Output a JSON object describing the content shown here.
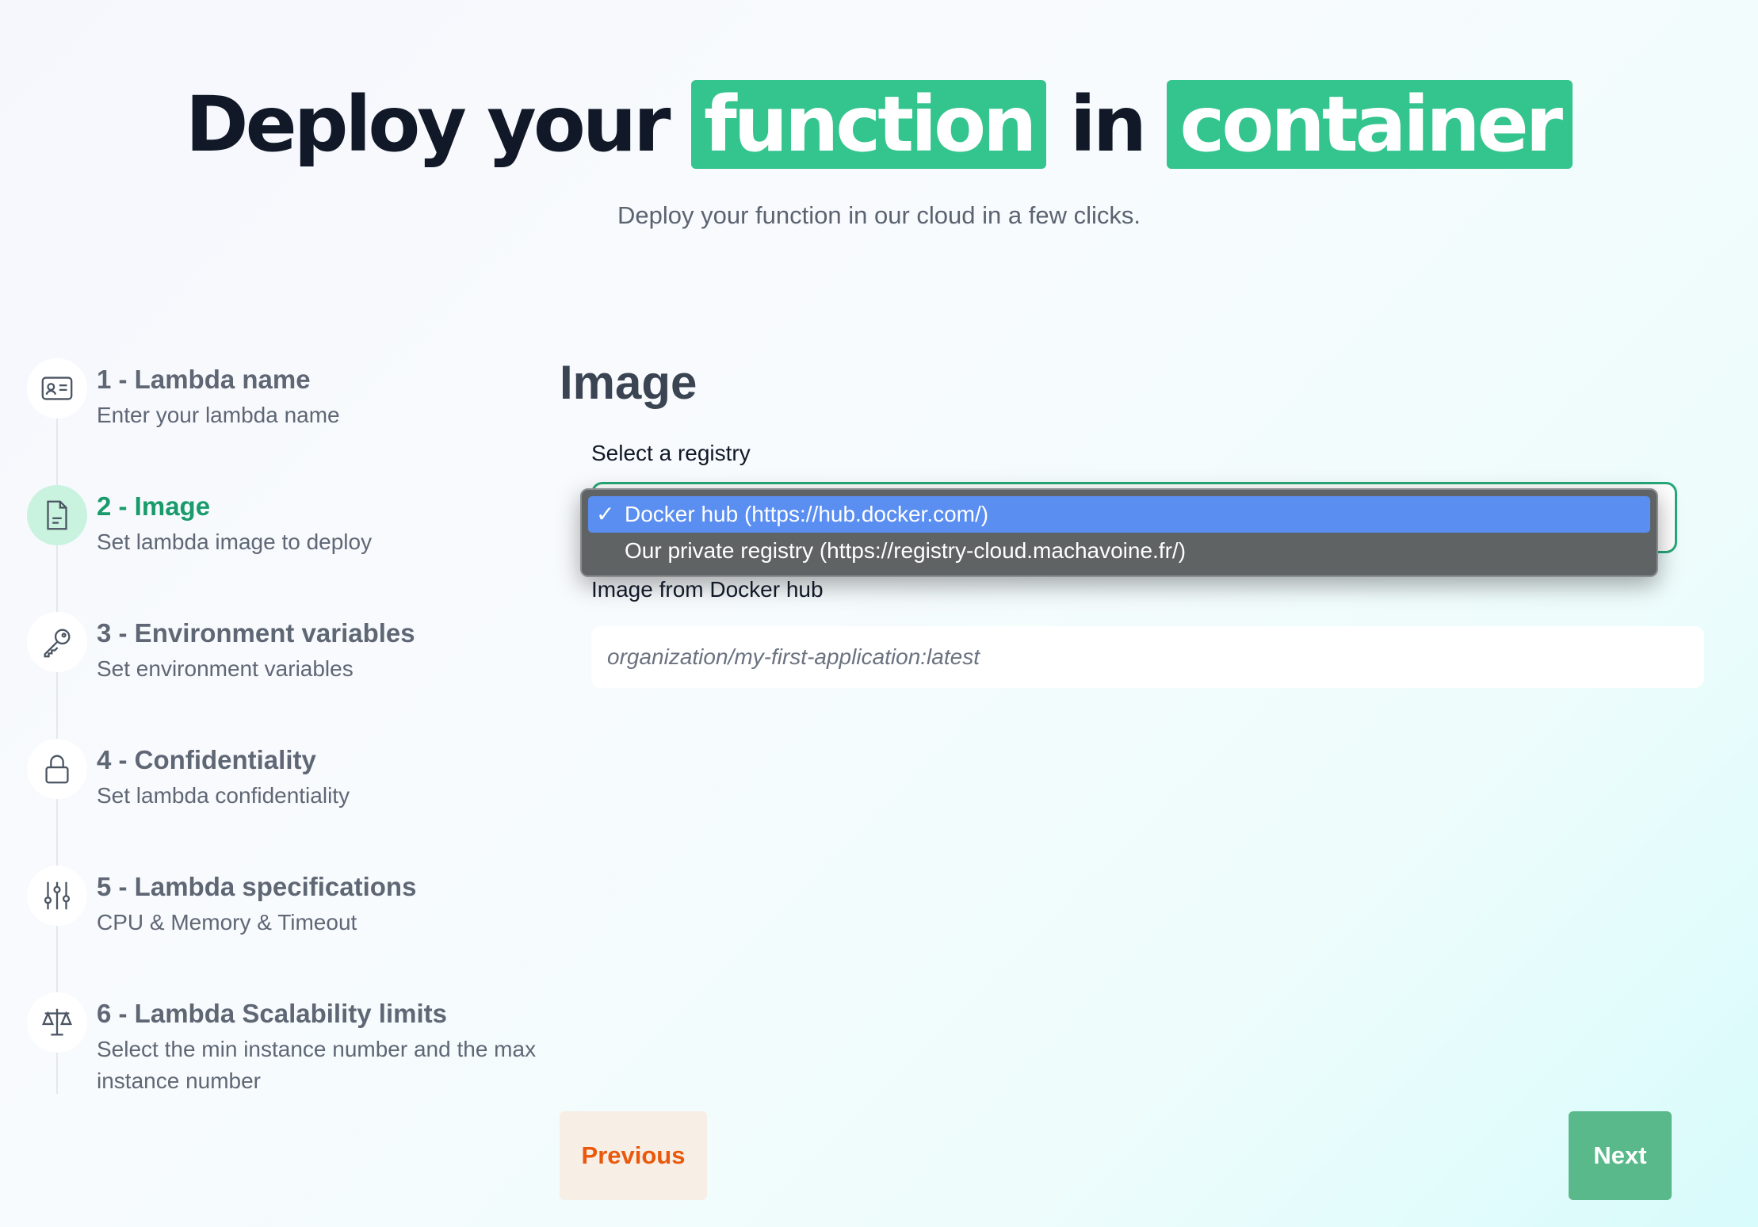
{
  "hero": {
    "title_part1": "Deploy your",
    "title_highlight1": "function",
    "title_part2": "in",
    "title_highlight2": "container",
    "subtitle": "Deploy your function in our cloud in a few clicks."
  },
  "steps": [
    {
      "title": "1 - Lambda name",
      "description": "Enter your lambda name",
      "icon": "id-card-icon",
      "active": false
    },
    {
      "title": "2 - Image",
      "description": "Set lambda image to deploy",
      "icon": "document-icon",
      "active": true
    },
    {
      "title": "3 - Environment variables",
      "description": "Set environment variables",
      "icon": "key-icon",
      "active": false
    },
    {
      "title": "4 - Confidentiality",
      "description": "Set lambda confidentiality",
      "icon": "lock-icon",
      "active": false
    },
    {
      "title": "5 - Lambda specifications",
      "description": "CPU & Memory & Timeout",
      "icon": "sliders-icon",
      "active": false
    },
    {
      "title": "6 - Lambda Scalability limits",
      "description": "Select the min instance number and the max instance number",
      "icon": "scale-icon",
      "active": false
    }
  ],
  "main": {
    "section_title": "Image",
    "registry_label": "Select a registry",
    "registry_options": [
      {
        "label": "Docker hub (https://hub.docker.com/)",
        "selected": true
      },
      {
        "label": "Our private registry (https://registry-cloud.machavoine.fr/)",
        "selected": false
      }
    ],
    "check_mark": "✓",
    "image_label": "Image from Docker hub",
    "image_placeholder": "organization/my-first-application:latest"
  },
  "buttons": {
    "previous": "Previous",
    "next": "Next"
  },
  "colors": {
    "accent": "#34c48e",
    "active_step": "#199b6b",
    "previous_text": "#ea580c",
    "next_bg": "#59b98a",
    "dropdown_selected": "#5a8ef0"
  }
}
